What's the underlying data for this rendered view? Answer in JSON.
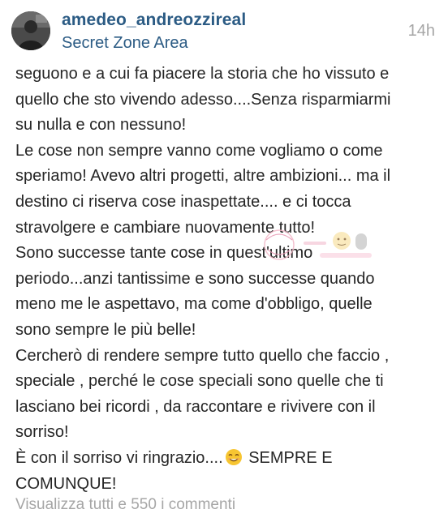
{
  "post": {
    "username": "amedeo_andreozzireal",
    "location": "Secret Zone Area",
    "time": "14h"
  },
  "caption": {
    "lines": [
      "seguono e a cui fa piacere la storia che ho vissuto e",
      "quello che sto vivendo adesso....Senza risparmiarmi",
      "su nulla e con nessuno!",
      "Le cose non sempre vanno come vogliamo o come",
      "speriamo! Avevo altri progetti, altre ambizioni... ma il",
      "destino ci riserva cose inaspettate.... e ci tocca",
      "stravolgere e cambiare nuovamente tutto!",
      "Sono successe tante cose in quest'ultimo",
      "periodo...anzi tantissime e sono successe quando",
      "meno me le aspettavo, ma come d'obbligo, quelle",
      "sono sempre le più belle!",
      "Cercherò di rendere sempre tutto quello che faccio ,",
      "speciale , perché le cose speciali sono quelle che ti",
      "lasciano bei ricordi , da raccontare e rivivere con il",
      "sorriso!"
    ],
    "last_line_before_emoji": "È con il sorriso vi ringrazio....",
    "last_line_after_emoji": " SEMPRE E",
    "final_line": "COMUNQUE!",
    "emoji": "smiling-face-emoji"
  },
  "footer": {
    "view_comments": "Visualizza tutti e 550 i commenti"
  }
}
